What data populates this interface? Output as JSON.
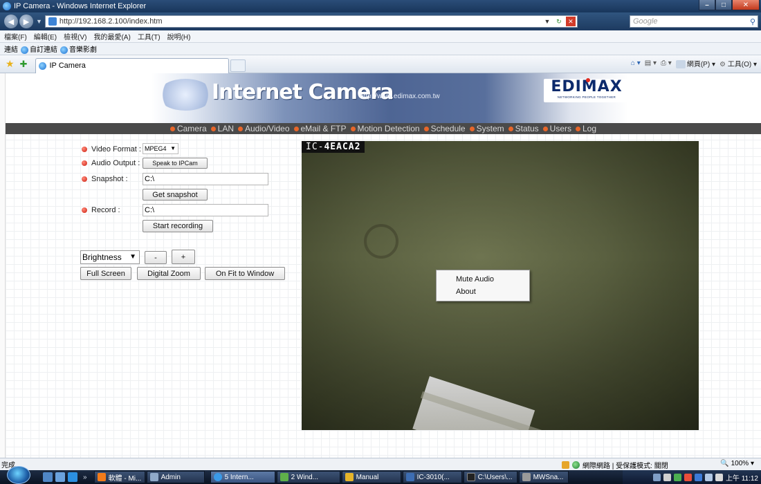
{
  "window": {
    "title": "IP Camera - Windows Internet Explorer"
  },
  "addressbar": {
    "url": "http://192.168.2.100/index.htm",
    "search_placeholder": "Google"
  },
  "menubar": {
    "items": [
      "檔案(F)",
      "編輯(E)",
      "檢視(V)",
      "我的最愛(A)",
      "工具(T)",
      "說明(H)"
    ]
  },
  "linksbar": {
    "label": "連結",
    "items": [
      "自訂連結",
      "音樂影劇"
    ]
  },
  "tabbar": {
    "tab_title": "IP Camera",
    "cmd_page": "網頁(P)",
    "cmd_tools": "工具(O)"
  },
  "banner": {
    "title": "Internet Camera",
    "url": "http://www.edimax.com.tw",
    "brand": "EDIMAX",
    "brand_tagline": "NETWORKING PEOPLE TOGETHER"
  },
  "nav": {
    "items": [
      "Camera",
      "LAN",
      "Audio/Video",
      "eMail & FTP",
      "Motion Detection",
      "Schedule",
      "System",
      "Status",
      "Users",
      "Log"
    ]
  },
  "controls": {
    "video_format_label": "Video Format :",
    "video_format_value": "MPEG4",
    "audio_output_label": "Audio Output :",
    "speak_button": "Speak to IPCam",
    "snapshot_label": "Snapshot :",
    "snapshot_path": "C:\\",
    "get_snapshot_button": "Get snapshot",
    "record_label": "Record :",
    "record_path": "C:\\",
    "start_recording_button": "Start recording",
    "adjust_select": "Brightness",
    "minus_button": "-",
    "plus_button": "+",
    "full_screen_button": "Full Screen",
    "digital_zoom_button": "Digital Zoom",
    "fit_window_button": "On Fit to Window"
  },
  "video": {
    "camera_label_prefix": "IC-",
    "camera_label_id": "4EACA2",
    "context_menu": [
      "Mute Audio",
      "About"
    ]
  },
  "statusbar": {
    "status": "完成",
    "zone": "網際網路 | 受保護模式: 關閉",
    "zoom": "100%"
  },
  "taskbar": {
    "tasks": [
      "軟體 - Mi...",
      "Admin",
      "5 Intern...",
      "2 Wind...",
      "Manual",
      "IC-3010(...",
      "C:\\Users\\...",
      "MWSna..."
    ],
    "clock": "上午 11:12"
  }
}
